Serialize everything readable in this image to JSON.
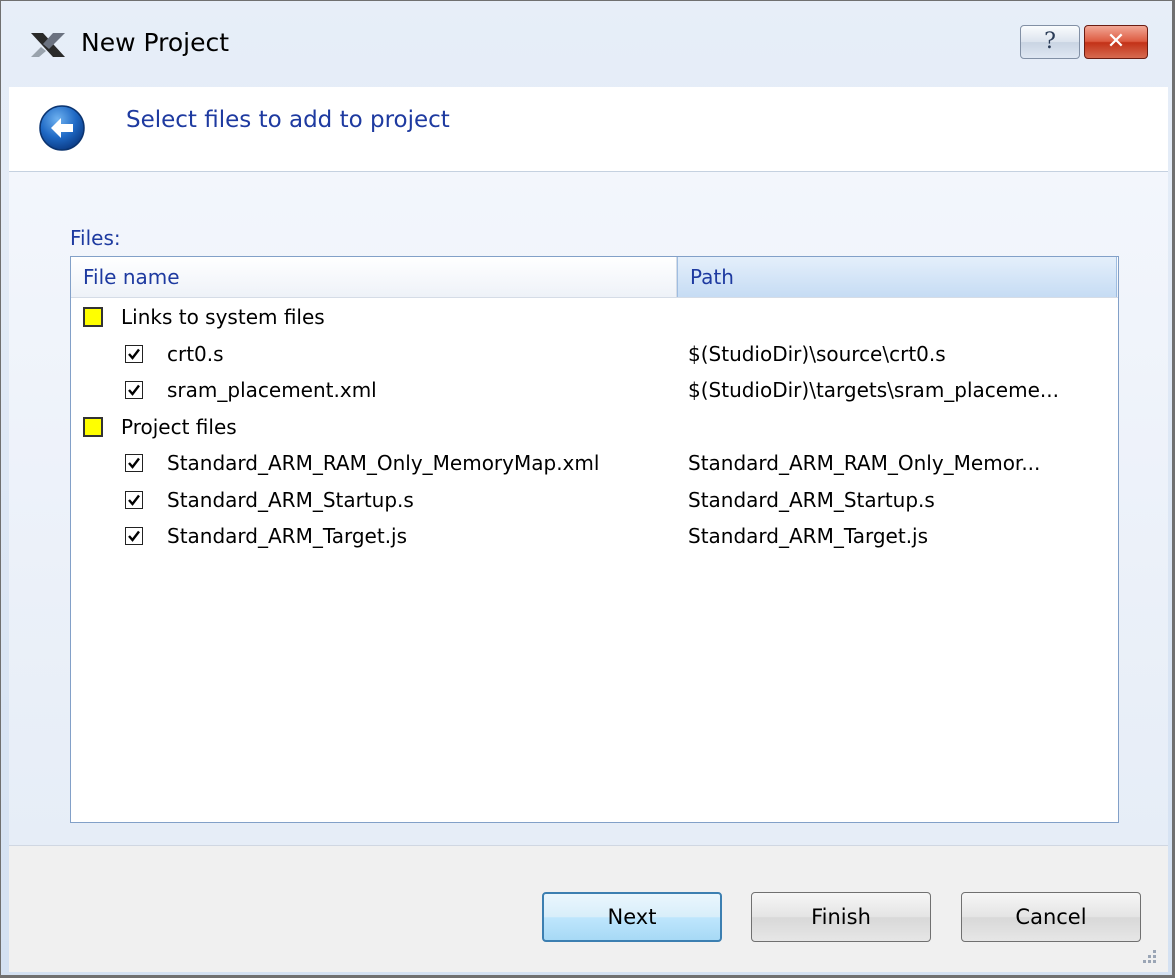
{
  "window": {
    "title": "New Project",
    "help_label": "?",
    "close_label": "✕"
  },
  "header": {
    "heading": "Select files to add to project",
    "back_icon": "back-arrow-icon"
  },
  "files": {
    "label": "Files:",
    "columns": {
      "name": "File name",
      "path": "Path"
    },
    "groups": [
      {
        "label": "Links to system files",
        "items": [
          {
            "name": "crt0.s",
            "path": "$(StudioDir)\\source\\crt0.s",
            "checked": true
          },
          {
            "name": "sram_placement.xml",
            "path": "$(StudioDir)\\targets\\sram_placeme...",
            "checked": true
          }
        ]
      },
      {
        "label": "Project files",
        "items": [
          {
            "name": "Standard_ARM_RAM_Only_MemoryMap.xml",
            "path": "Standard_ARM_RAM_Only_Memor...",
            "checked": true
          },
          {
            "name": "Standard_ARM_Startup.s",
            "path": "Standard_ARM_Startup.s",
            "checked": true
          },
          {
            "name": "Standard_ARM_Target.js",
            "path": "Standard_ARM_Target.js",
            "checked": true
          }
        ]
      }
    ]
  },
  "buttons": {
    "next": "Next",
    "finish": "Finish",
    "cancel": "Cancel"
  },
  "colors": {
    "heading": "#1e3aa0",
    "group_marker": "#ffff00",
    "close_button": "#c33218"
  }
}
